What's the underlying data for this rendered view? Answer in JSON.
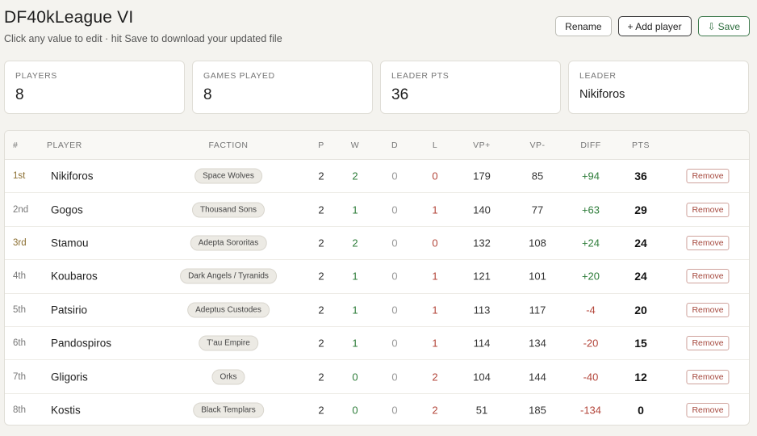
{
  "page": {
    "title": "DF40kLeague VI",
    "subtitle": "Click any value to edit · hit Save to download your updated file"
  },
  "actions": {
    "rename": "Rename",
    "add_player": "+ Add player",
    "save_icon": "⇩",
    "save": "Save"
  },
  "stats": [
    {
      "label": "PLAYERS",
      "value": "8"
    },
    {
      "label": "GAMES PLAYED",
      "value": "8"
    },
    {
      "label": "LEADER PTS",
      "value": "36"
    },
    {
      "label": "LEADER",
      "value": "Nikiforos"
    }
  ],
  "table": {
    "headers": [
      "#",
      "PLAYER",
      "FACTION",
      "P",
      "W",
      "D",
      "L",
      "VP+",
      "VP-",
      "DIFF",
      "PTS"
    ],
    "remove_label": "Remove",
    "rows": [
      {
        "rank": "1st",
        "player": "Nikiforos",
        "faction": "Space Wolves",
        "p": "2",
        "w": "2",
        "d": "0",
        "l": "0",
        "vp_plus": "179",
        "vp_minus": "85",
        "diff": "+94",
        "pts": "36"
      },
      {
        "rank": "2nd",
        "player": "Gogos",
        "faction": "Thousand Sons",
        "p": "2",
        "w": "1",
        "d": "0",
        "l": "1",
        "vp_plus": "140",
        "vp_minus": "77",
        "diff": "+63",
        "pts": "29"
      },
      {
        "rank": "3rd",
        "player": "Stamou",
        "faction": "Adepta Sororitas",
        "p": "2",
        "w": "2",
        "d": "0",
        "l": "0",
        "vp_plus": "132",
        "vp_minus": "108",
        "diff": "+24",
        "pts": "24"
      },
      {
        "rank": "4th",
        "player": "Koubaros",
        "faction": "Dark Angels / Tyranids",
        "p": "2",
        "w": "1",
        "d": "0",
        "l": "1",
        "vp_plus": "121",
        "vp_minus": "101",
        "diff": "+20",
        "pts": "24"
      },
      {
        "rank": "5th",
        "player": "Patsirio",
        "faction": "Adeptus Custodes",
        "p": "2",
        "w": "1",
        "d": "0",
        "l": "1",
        "vp_plus": "113",
        "vp_minus": "117",
        "diff": "-4",
        "pts": "20"
      },
      {
        "rank": "6th",
        "player": "Pandospiros",
        "faction": "T'au Empire",
        "p": "2",
        "w": "1",
        "d": "0",
        "l": "1",
        "vp_plus": "114",
        "vp_minus": "134",
        "diff": "-20",
        "pts": "15"
      },
      {
        "rank": "7th",
        "player": "Gligoris",
        "faction": "Orks",
        "p": "2",
        "w": "0",
        "d": "0",
        "l": "2",
        "vp_plus": "104",
        "vp_minus": "144",
        "diff": "-40",
        "pts": "12"
      },
      {
        "rank": "8th",
        "player": "Kostis",
        "faction": "Black Templars",
        "p": "2",
        "w": "0",
        "d": "0",
        "l": "2",
        "vp_plus": "51",
        "vp_minus": "185",
        "diff": "-134",
        "pts": "0"
      }
    ]
  }
}
